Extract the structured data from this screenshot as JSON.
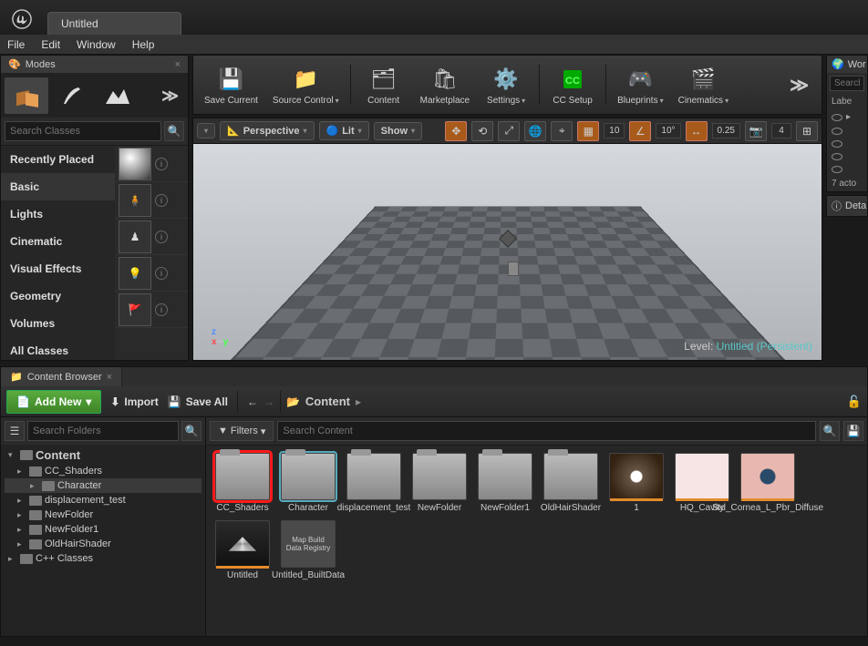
{
  "title_tab": "Untitled",
  "menu": [
    "File",
    "Edit",
    "Window",
    "Help"
  ],
  "modes": {
    "title": "Modes",
    "search_placeholder": "Search Classes",
    "categories": [
      "Recently Placed",
      "Basic",
      "Lights",
      "Cinematic",
      "Visual Effects",
      "Geometry",
      "Volumes",
      "All Classes"
    ],
    "selected_category": "Basic"
  },
  "toolbar": {
    "save": "Save Current",
    "source_control": "Source Control",
    "content": "Content",
    "marketplace": "Marketplace",
    "settings": "Settings",
    "cc_setup": "CC Setup",
    "blueprints": "Blueprints",
    "cinematics": "Cinematics"
  },
  "viewport": {
    "perspective": "Perspective",
    "lit": "Lit",
    "show": "Show",
    "grid_val": "10",
    "angle_val": "10°",
    "scale_val": "0.25",
    "cam_val": "4",
    "level_prefix": "Level:",
    "level_name": "Untitled (Persistent)"
  },
  "outliner": {
    "title": "Wor",
    "search_placeholder": "Search...",
    "label": "Labe",
    "count": "7 acto"
  },
  "details": {
    "title": "Deta"
  },
  "content_browser": {
    "tab": "Content Browser",
    "add_new": "Add New",
    "import": "Import",
    "save_all": "Save All",
    "path": "Content",
    "folders_placeholder": "Search Folders",
    "filters": "Filters",
    "content_placeholder": "Search Content",
    "tree": [
      {
        "name": "Content",
        "level": 0,
        "expanded": true,
        "root": true
      },
      {
        "name": "CC_Shaders",
        "level": 1
      },
      {
        "name": "Character",
        "level": 2,
        "sel": true
      },
      {
        "name": "displacement_test",
        "level": 1
      },
      {
        "name": "NewFolder",
        "level": 1
      },
      {
        "name": "NewFolder1",
        "level": 1
      },
      {
        "name": "OldHairShader",
        "level": 1
      },
      {
        "name": "C++ Classes",
        "level": 0
      }
    ],
    "assets": [
      {
        "name": "CC_Shaders",
        "type": "folder",
        "highlighted": true
      },
      {
        "name": "Character",
        "type": "folder",
        "selected": true
      },
      {
        "name": "displacement_test",
        "type": "folder"
      },
      {
        "name": "NewFolder",
        "type": "folder"
      },
      {
        "name": "NewFolder1",
        "type": "folder"
      },
      {
        "name": "OldHairShader",
        "type": "folder"
      },
      {
        "name": "1",
        "type": "tex1"
      },
      {
        "name": "HQ_Cavity",
        "type": "tex2"
      },
      {
        "name": "Std_Cornea_L_Pbr_Diffuse",
        "type": "tex3"
      },
      {
        "name": "Untitled",
        "type": "level"
      },
      {
        "name": "Untitled_BuiltData",
        "type": "data",
        "inner": "Map Build Data Registry"
      }
    ]
  }
}
